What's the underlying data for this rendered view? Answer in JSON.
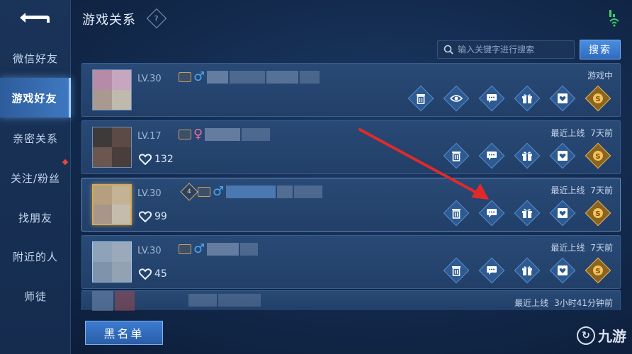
{
  "header": {
    "title": "游戏关系",
    "help_glyph": "?",
    "search_placeholder": "输入关键字进行搜索",
    "search_button": "搜索"
  },
  "sidebar": {
    "items": [
      {
        "label": "微信好友",
        "active": false
      },
      {
        "label": "游戏好友",
        "active": true
      },
      {
        "label": "亲密关系",
        "active": false
      },
      {
        "label": "关注/粉丝",
        "active": false,
        "dot": true
      },
      {
        "label": "找朋友",
        "active": false
      },
      {
        "label": "附近的人",
        "active": false
      },
      {
        "label": "师徒",
        "active": false
      }
    ]
  },
  "friends": [
    {
      "level": "LV.30",
      "gender": "♂",
      "status_label": "游戏中",
      "status_time": "",
      "hearts": ""
    },
    {
      "level": "LV.17",
      "gender": "♀",
      "status_label": "最近上线",
      "status_time": "7天前",
      "hearts": "132"
    },
    {
      "level": "LV.30",
      "gender": "♂",
      "status_label": "最近上线",
      "status_time": "7天前",
      "hearts": "99",
      "rank_badge": "4"
    },
    {
      "level": "LV.30",
      "gender": "♂",
      "status_label": "最近上线",
      "status_time": "7天前",
      "hearts": "45"
    },
    {
      "level": "",
      "gender": "",
      "status_label": "最近上线",
      "status_time": "3小时41分钟前",
      "hearts": ""
    }
  ],
  "footer": {
    "blacklist_button": "黑名单",
    "watermark": "九游"
  },
  "colors": {
    "accent": "#3f78c0",
    "male": "#4aa6f0",
    "female": "#f06ca0",
    "arrow": "#e02a2a"
  }
}
